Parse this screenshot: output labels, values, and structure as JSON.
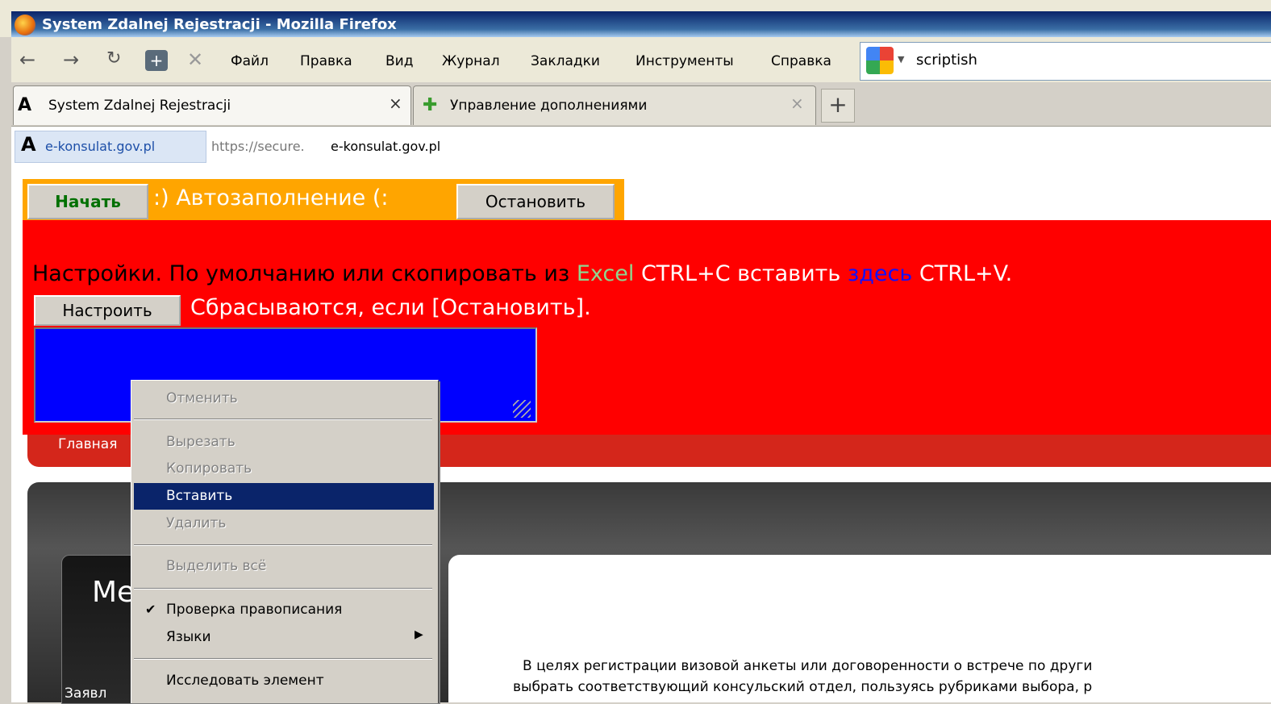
{
  "window": {
    "title": "System Zdalnej Rejestracji - Mozilla Firefox"
  },
  "menu": [
    "Файл",
    "Правка",
    "Вид",
    "Журнал",
    "Закладки",
    "Инструменты",
    "Справка"
  ],
  "search": {
    "value": "scriptish"
  },
  "tabs": [
    {
      "label": "System Zdalnej Rejestracji",
      "close": "×"
    },
    {
      "label": "Управление дополнениями",
      "close": "×"
    }
  ],
  "new_tab_label": "+",
  "url": {
    "site_identity": "e-konsulat.gov.pl",
    "scheme": "https://secure.",
    "host": "e-konsulat.gov.pl"
  },
  "toolbar": {
    "start": "Начать",
    "autofill": ":) Автозаполнение (:",
    "stop": "Остановить"
  },
  "settings": {
    "prefix": "Настройки. По умолчанию или скопировать из ",
    "excel": "Excel",
    "mid": " CTRL+C вставить ",
    "here": "здесь",
    "suffix": " CTRL+V.",
    "configure_button": "Настроить",
    "reset_note": "Сбрасываются, если [Остановить]."
  },
  "site": {
    "nav_home": "Главная",
    "menu_title": "Ме",
    "menu_apply": "Заявл",
    "intro_line1": "В целях регистрации визовой анкеты или договоренности о встрече по други",
    "intro_line2": "выбрать соответствующий консульский отдел, пользуясь рубриками выбора, р"
  },
  "context_menu": {
    "undo": "Отменить",
    "cut": "Вырезать",
    "copy": "Копировать",
    "paste": "Вставить",
    "delete": "Удалить",
    "select_all": "Выделить всё",
    "spellcheck": "Проверка правописания",
    "languages": "Языки",
    "inspect": "Исследовать элемент"
  }
}
